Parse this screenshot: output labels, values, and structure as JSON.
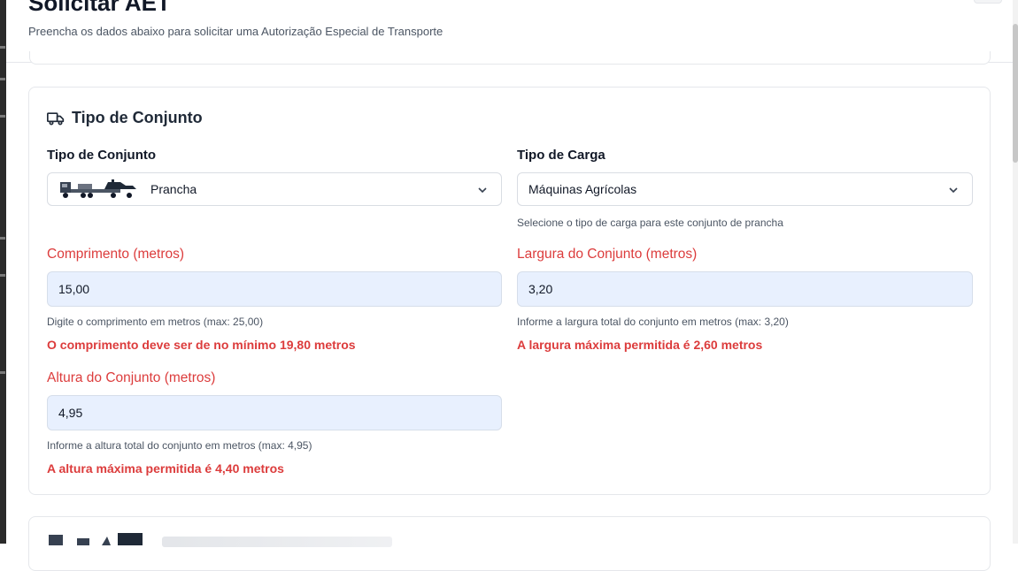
{
  "header": {
    "title": "Solicitar AET",
    "subtitle": "Preencha os dados abaixo para solicitar uma Autorização Especial de Transporte"
  },
  "section": {
    "title": "Tipo de Conjunto",
    "icon": "truck-icon"
  },
  "form": {
    "tipo_conjunto": {
      "label": "Tipo de Conjunto",
      "value": "Prancha",
      "icon": "prancha-vehicle-icon"
    },
    "tipo_carga": {
      "label": "Tipo de Carga",
      "value": "Máquinas Agrícolas",
      "help": "Selecione o tipo de carga para este conjunto de prancha"
    },
    "comprimento": {
      "label": "Comprimento (metros)",
      "value": "15,00",
      "help": "Digite o comprimento em metros (max: 25,00)",
      "error": "O comprimento deve ser de no mínimo 19,80 metros"
    },
    "largura": {
      "label": "Largura do Conjunto (metros)",
      "value": "3,20",
      "help": "Informe a largura total do conjunto em metros (max: 3,20)",
      "error": "A largura máxima permitida é 2,60 metros"
    },
    "altura": {
      "label": "Altura do Conjunto (metros)",
      "value": "4,95",
      "help": "Informe a altura total do conjunto em metros (max: 4,95)",
      "error": "A altura máxima permitida é 4,40 metros"
    }
  },
  "colors": {
    "error": "#dc3c3c",
    "input_bg": "#e8f0fe",
    "border": "#e5e7eb"
  }
}
